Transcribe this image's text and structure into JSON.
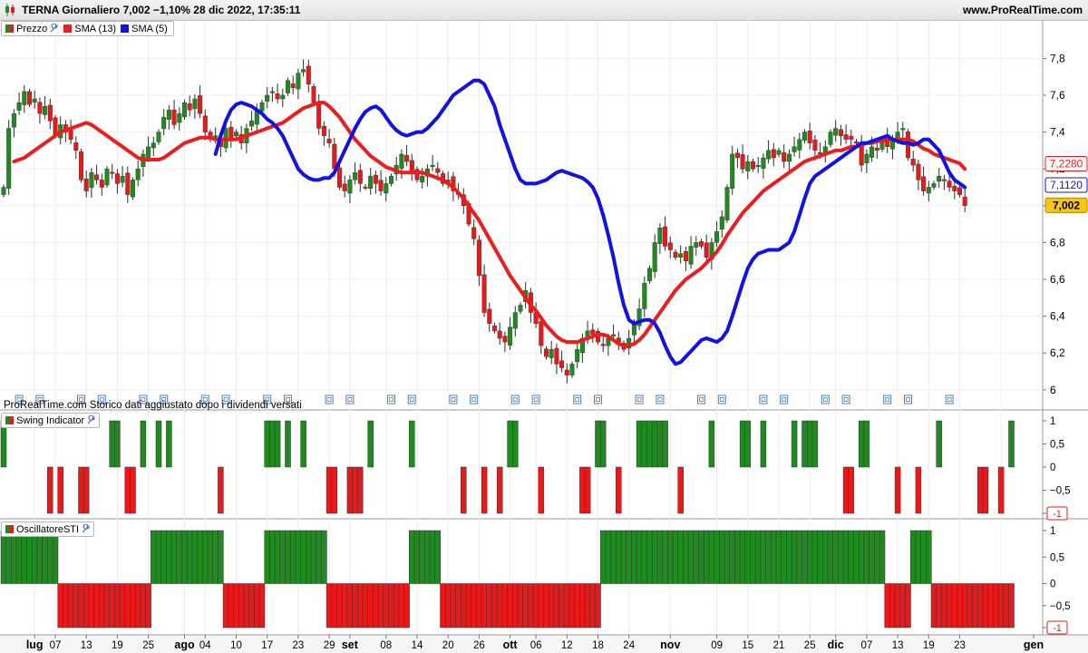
{
  "header": {
    "title": "TERNA Giornaliero 7,002 −1,10% 28 dic 2022, 17:35:11",
    "site": "www.ProRealTime.com"
  },
  "price_panel": {
    "legend": [
      "Prezzo",
      "SMA (13)",
      "SMA (5)"
    ],
    "note": "ProRealTime.com Storico dati aggiustato dopo i dividendi versati",
    "y_ticks": [
      "7,8",
      "7,6",
      "7,4",
      "7,2",
      "7",
      "6,8",
      "6,6",
      "6,4",
      "6,2",
      "6"
    ],
    "markers": {
      "sma13": "7,2280",
      "sma5": "7,1120",
      "last": "7,002"
    }
  },
  "swing_panel": {
    "title": "Swing Indicator",
    "y_ticks": [
      "1",
      "0,5",
      "0",
      "−0,5",
      "-1"
    ]
  },
  "sti_panel": {
    "title": "OscillatoreSTI",
    "y_ticks": [
      "1",
      "0,5",
      "0",
      "−0,5",
      "-1"
    ]
  },
  "x_axis": {
    "labels": [
      {
        "text": "lug",
        "bold": true,
        "i": 6
      },
      {
        "text": "07",
        "i": 10
      },
      {
        "text": "13",
        "i": 16
      },
      {
        "text": "19",
        "i": 22
      },
      {
        "text": "25",
        "i": 28
      },
      {
        "text": "ago",
        "bold": true,
        "i": 35
      },
      {
        "text": "04",
        "i": 39
      },
      {
        "text": "10",
        "i": 45
      },
      {
        "text": "17",
        "i": 51
      },
      {
        "text": "23",
        "i": 57
      },
      {
        "text": "29",
        "i": 63
      },
      {
        "text": "set",
        "bold": true,
        "i": 67
      },
      {
        "text": "08",
        "i": 74
      },
      {
        "text": "14",
        "i": 80
      },
      {
        "text": "20",
        "i": 86
      },
      {
        "text": "26",
        "i": 92
      },
      {
        "text": "ott",
        "bold": true,
        "i": 98
      },
      {
        "text": "06",
        "i": 103
      },
      {
        "text": "12",
        "i": 109
      },
      {
        "text": "18",
        "i": 115
      },
      {
        "text": "24",
        "i": 121
      },
      {
        "text": "nov",
        "bold": true,
        "i": 129
      },
      {
        "text": "09",
        "i": 138
      },
      {
        "text": "15",
        "i": 144
      },
      {
        "text": "21",
        "i": 150
      },
      {
        "text": "25",
        "i": 156
      },
      {
        "text": "dic",
        "bold": true,
        "i": 161
      },
      {
        "text": "07",
        "i": 167
      },
      {
        "text": "13",
        "i": 173
      },
      {
        "text": "19",
        "i": 179
      },
      {
        "text": "23",
        "i": 185
      },
      {
        "text": "gen",
        "bold": true,
        "i": 193
      }
    ]
  },
  "colors": {
    "up": "#1f8a1f",
    "down": "#e8191b",
    "sma13": "#ee1c1c",
    "sma5": "#1212e6",
    "last_bg": "#f5c518"
  },
  "chart_data": [
    {
      "type": "candlestick",
      "title": "TERNA Giornaliero",
      "ylim": [
        5.95,
        7.92
      ],
      "ohlc_close": [
        7.1,
        7.42,
        7.5,
        7.56,
        7.62,
        7.55,
        7.58,
        7.5,
        7.54,
        7.46,
        7.38,
        7.44,
        7.4,
        7.36,
        7.3,
        7.14,
        7.08,
        7.18,
        7.14,
        7.1,
        7.2,
        7.18,
        7.12,
        7.16,
        7.06,
        7.14,
        7.2,
        7.28,
        7.32,
        7.34,
        7.4,
        7.48,
        7.52,
        7.44,
        7.5,
        7.56,
        7.52,
        7.58,
        7.5,
        7.4,
        7.36,
        7.38,
        7.32,
        7.42,
        7.36,
        7.4,
        7.34,
        7.42,
        7.46,
        7.52,
        7.56,
        7.6,
        7.62,
        7.58,
        7.6,
        7.68,
        7.64,
        7.72,
        7.74,
        7.66,
        7.56,
        7.42,
        7.38,
        7.34,
        7.2,
        7.1,
        7.08,
        7.14,
        7.18,
        7.12,
        7.1,
        7.16,
        7.12,
        7.08,
        7.12,
        7.16,
        7.22,
        7.28,
        7.24,
        7.18,
        7.14,
        7.16,
        7.2,
        7.22,
        7.18,
        7.12,
        7.14,
        7.08,
        7.06,
        7.0,
        6.9,
        6.82,
        6.62,
        6.42,
        6.36,
        6.32,
        6.28,
        6.26,
        6.34,
        6.42,
        6.46,
        6.54,
        6.42,
        6.36,
        6.24,
        6.18,
        6.22,
        6.14,
        6.12,
        6.08,
        6.14,
        6.22,
        6.28,
        6.32,
        6.3,
        6.26,
        6.24,
        6.28,
        6.3,
        6.26,
        6.22,
        6.28,
        6.36,
        6.44,
        6.58,
        6.66,
        6.8,
        6.88,
        6.78,
        6.76,
        6.72,
        6.74,
        6.7,
        6.78,
        6.8,
        6.78,
        6.72,
        6.8,
        6.86,
        6.94,
        7.1,
        7.28,
        7.26,
        7.2,
        7.24,
        7.2,
        7.22,
        7.26,
        7.3,
        7.26,
        7.3,
        7.24,
        7.28,
        7.32,
        7.36,
        7.4,
        7.34,
        7.3,
        7.28,
        7.32,
        7.4,
        7.42,
        7.38,
        7.36,
        7.36,
        7.34,
        7.22,
        7.28,
        7.32,
        7.3,
        7.36,
        7.32,
        7.36,
        7.4,
        7.42,
        7.26,
        7.22,
        7.14,
        7.08,
        7.1,
        7.12,
        7.16,
        7.14,
        7.1,
        7.08,
        7.06,
        7.0
      ],
      "sma13_start_index": 0,
      "sma13": [
        7.24,
        7.25,
        7.26,
        7.28,
        7.3,
        7.32,
        7.34,
        7.36,
        7.38,
        7.4,
        7.41,
        7.42,
        7.43,
        7.44,
        7.45,
        7.44,
        7.42,
        7.4,
        7.38,
        7.36,
        7.34,
        7.32,
        7.3,
        7.28,
        7.26,
        7.25,
        7.25,
        7.25,
        7.25,
        7.26,
        7.28,
        7.3,
        7.32,
        7.34,
        7.35,
        7.36,
        7.37,
        7.37,
        7.37,
        7.36,
        7.36,
        7.36,
        7.36,
        7.36,
        7.37,
        7.38,
        7.39,
        7.4,
        7.41,
        7.42,
        7.43,
        7.44,
        7.45,
        7.47,
        7.49,
        7.51,
        7.53,
        7.54,
        7.55,
        7.56,
        7.56,
        7.54,
        7.51,
        7.48,
        7.44,
        7.4,
        7.36,
        7.33,
        7.3,
        7.27,
        7.25,
        7.23,
        7.21,
        7.2,
        7.19,
        7.18,
        7.18,
        7.18,
        7.18,
        7.18,
        7.17,
        7.16,
        7.15,
        7.14,
        7.12,
        7.1,
        7.07,
        7.04,
        7.0,
        6.96,
        6.92,
        6.87,
        6.82,
        6.77,
        6.72,
        6.67,
        6.62,
        6.58,
        6.54,
        6.5,
        6.46,
        6.43,
        6.39,
        6.35,
        6.32,
        6.29,
        6.27,
        6.26,
        6.26,
        6.26,
        6.27,
        6.28,
        6.29,
        6.3,
        6.3,
        6.29,
        6.27,
        6.25,
        6.24,
        6.24,
        6.25,
        6.27,
        6.3,
        6.34,
        6.38,
        6.42,
        6.46,
        6.5,
        6.54,
        6.57,
        6.6,
        6.62,
        6.64,
        6.66,
        6.69,
        6.72,
        6.75,
        6.79,
        6.84,
        6.88,
        6.92,
        6.96,
        6.99,
        7.02,
        7.05,
        7.08,
        7.1,
        7.12,
        7.14,
        7.16,
        7.18,
        7.2,
        7.22,
        7.24,
        7.25,
        7.26,
        7.27,
        7.28,
        7.29,
        7.3,
        7.3,
        7.31,
        7.32,
        7.32,
        7.33,
        7.34,
        7.34,
        7.35,
        7.35,
        7.36,
        7.36,
        7.36,
        7.36,
        7.36,
        7.35,
        7.33,
        7.31,
        7.3,
        7.28,
        7.27,
        7.26,
        7.25,
        7.24,
        7.23,
        7.2
      ],
      "sma5": [
        7.28,
        7.38,
        7.46,
        7.52,
        7.55,
        7.56,
        7.55,
        7.54,
        7.52,
        7.5,
        7.47,
        7.45,
        7.42,
        7.38,
        7.32,
        7.26,
        7.2,
        7.17,
        7.15,
        7.14,
        7.14,
        7.15,
        7.15,
        7.18,
        7.24,
        7.3,
        7.36,
        7.42,
        7.47,
        7.51,
        7.53,
        7.54,
        7.52,
        7.48,
        7.44,
        7.41,
        7.39,
        7.38,
        7.39,
        7.4,
        7.4,
        7.42,
        7.45,
        7.48,
        7.52,
        7.56,
        7.6,
        7.62,
        7.64,
        7.66,
        7.68,
        7.68,
        7.66,
        7.6,
        7.54,
        7.44,
        7.36,
        7.28,
        7.2,
        7.14,
        7.12,
        7.12,
        7.12,
        7.13,
        7.14,
        7.16,
        7.18,
        7.19,
        7.18,
        7.17,
        7.16,
        7.15,
        7.13,
        7.1,
        7.04,
        6.95,
        6.84,
        6.72,
        6.58,
        6.46,
        6.38,
        6.36,
        6.37,
        6.38,
        6.38,
        6.36,
        6.31,
        6.24,
        6.18,
        6.14,
        6.15,
        6.18,
        6.21,
        6.24,
        6.27,
        6.28,
        6.27,
        6.26,
        6.28,
        6.32,
        6.4,
        6.49,
        6.58,
        6.66,
        6.71,
        6.74,
        6.75,
        6.76,
        6.76,
        6.76,
        6.78,
        6.8,
        6.86,
        6.95,
        7.04,
        7.12,
        7.16,
        7.18,
        7.2,
        7.22,
        7.24,
        7.26,
        7.28,
        7.3,
        7.32,
        7.34,
        7.34,
        7.35,
        7.36,
        7.37,
        7.38,
        7.36,
        7.35,
        7.34,
        7.34,
        7.33,
        7.34,
        7.36,
        7.36,
        7.33,
        7.3,
        7.24,
        7.18,
        7.14,
        7.12,
        7.1
      ]
    },
    {
      "type": "bar",
      "title": "Swing Indicator",
      "ylim": [
        -1,
        1
      ],
      "pattern": "alternating +1 (green) / -1 (red) / 0 signals"
    },
    {
      "type": "bar",
      "title": "OscillatoreSTI",
      "ylim": [
        -1,
        1
      ],
      "pattern": "blocks of +1 (green) and -1 (red)"
    }
  ]
}
